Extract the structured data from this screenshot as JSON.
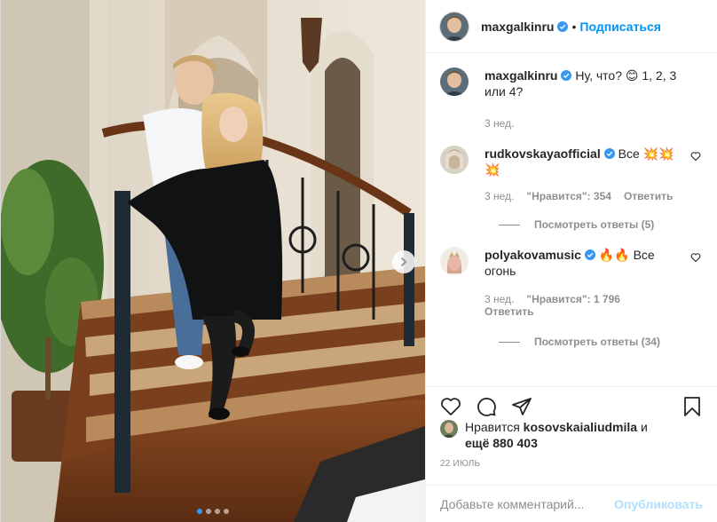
{
  "post": {
    "author": "maxgalkinru",
    "follow_label": "Подписаться",
    "separator": "•"
  },
  "caption": {
    "username": "maxgalkinru",
    "text": "Ну, что? 😊 1, 2, 3 или 4?",
    "time": "3 нед."
  },
  "comments": [
    {
      "username": "rudkovskayaofficial",
      "text": "Все 💥💥💥",
      "time": "3 нед.",
      "likes": "\"Нравится\": 354",
      "reply_label": "Ответить",
      "view_replies": "Посмотреть ответы (5)"
    },
    {
      "username": "polyakovamusic",
      "text": "🔥🔥 Все огонь",
      "time": "3 нед.",
      "likes": "\"Нравится\": 1 796",
      "reply_label": "Ответить",
      "view_replies": "Посмотреть ответы (34)"
    }
  ],
  "likes": {
    "prefix": "Нравится",
    "user": "kosovskaialiudmila",
    "and": "и",
    "others": "ещё 880 403"
  },
  "date": "22 ИЮЛЬ",
  "add_comment": {
    "placeholder": "Добавьте комментарий...",
    "publish_label": "Опубликовать"
  },
  "carousel": {
    "slides": 4,
    "active": 1
  },
  "colors": {
    "link": "#0095f6",
    "publish_disabled": "#b2dffc",
    "verified": "#3897f0",
    "muted": "#8e8e8e"
  },
  "icons": [
    "verified-icon",
    "heart-icon",
    "comment-icon",
    "share-icon",
    "save-icon",
    "chevron-right-icon"
  ]
}
